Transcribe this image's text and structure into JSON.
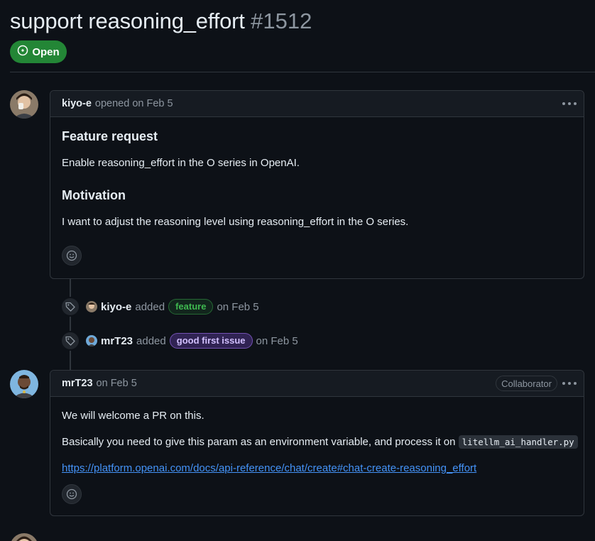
{
  "issue": {
    "title": "support reasoning_effort",
    "number": "#1512",
    "state": "Open"
  },
  "comments": [
    {
      "author": "kiyo-e",
      "action_text": "opened on Feb 5",
      "sections": [
        {
          "heading": "Feature request",
          "text": "Enable reasoning_effort in the O series in OpenAI."
        },
        {
          "heading": "Motivation",
          "text": "I want to adjust the reasoning level using reasoning_effort in the O series."
        }
      ]
    },
    {
      "author": "mrT23",
      "action_text": "on Feb 5",
      "role": "Collaborator",
      "para1": "We will welcome a PR on this.",
      "para2_prefix": "Basically you need to give this param as an environment variable, and process it on",
      "code": "litellm_ai_handler.py",
      "link": "https://platform.openai.com/docs/api-reference/chat/create#chat-create-reasoning_effort"
    }
  ],
  "events": [
    {
      "actor": "kiyo-e",
      "verb": "added",
      "label": "feature",
      "date": "on Feb 5"
    },
    {
      "actor": "mrT23",
      "verb": "added",
      "label": "good first issue",
      "date": "on Feb 5"
    }
  ],
  "colors": {
    "open_green": "#238636",
    "link_blue": "#4493f8",
    "label_feature": "#3fb950",
    "label_good_first_issue": "#d2c1ff"
  },
  "icons": [
    "issue-open-icon",
    "kebab-icon",
    "smiley-icon",
    "tag-icon"
  ]
}
